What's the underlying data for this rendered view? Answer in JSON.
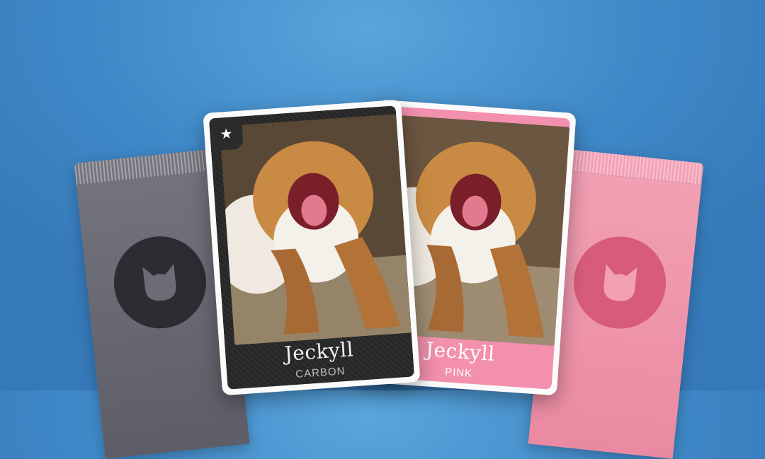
{
  "cards": {
    "carbon": {
      "name": "Jeckyll",
      "edition": "CARBON",
      "badge_icon": "star-icon",
      "badge_glyph": "★"
    },
    "pink": {
      "name": "Jeckyll",
      "edition": "PINK"
    }
  },
  "packs": {
    "left": {
      "color": "#6a6a74",
      "emblem_icon": "cat-head-icon"
    },
    "right": {
      "color": "#f096ad",
      "emblem_icon": "cat-head-icon"
    }
  },
  "colors": {
    "background": "#3f89c8",
    "carbon": "#2a2a2a",
    "pink": "#f290ad"
  }
}
